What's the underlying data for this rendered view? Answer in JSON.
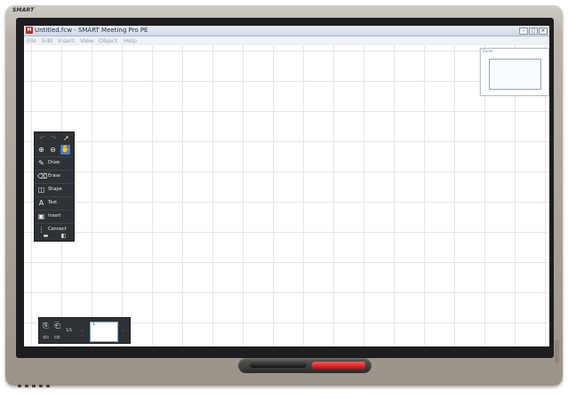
{
  "device": {
    "brand": "SMART"
  },
  "window": {
    "app_icon": "app-logo-icon",
    "title": "Untitled.fcw - SMART Meeting Pro PE",
    "controls": [
      "minimize-icon",
      "maximize-icon",
      "close-icon"
    ]
  },
  "menu": {
    "items": [
      "File",
      "Edit",
      "Insert",
      "View",
      "Object",
      "Help"
    ]
  },
  "navigator": {
    "label": "Zoom"
  },
  "toolbar": {
    "top_icons": [
      "undo-icon",
      "redo-icon",
      "select-pointer-icon"
    ],
    "zoom_icons": [
      "zoom-in-icon",
      "zoom-out-icon",
      "pan-hand-icon"
    ],
    "tools": [
      {
        "label": "Draw",
        "icon": "pen-icon"
      },
      {
        "label": "Erase",
        "icon": "eraser-icon"
      },
      {
        "label": "Shape",
        "icon": "shape-icon"
      },
      {
        "label": "Text",
        "icon": "text-icon"
      },
      {
        "label": "Insert",
        "icon": "insert-icon"
      },
      {
        "label": "Connect",
        "icon": "connect-icon"
      }
    ],
    "bottom_icons": [
      "collapse-icon",
      "panel-toggle-icon"
    ]
  },
  "pages": {
    "counter": "1/1",
    "thumbnail_number": "1"
  }
}
